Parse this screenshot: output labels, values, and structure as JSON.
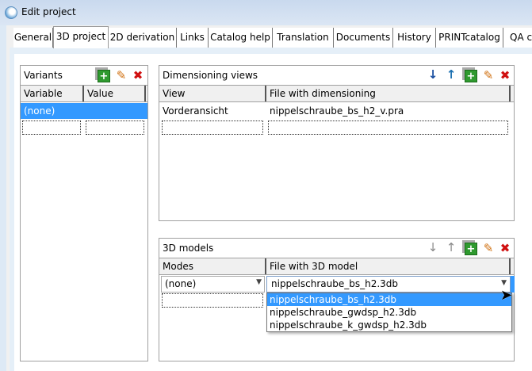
{
  "window": {
    "title": "Edit project"
  },
  "tabs": [
    {
      "label": "General"
    },
    {
      "label": "3D project",
      "selected": true
    },
    {
      "label": "2D derivation"
    },
    {
      "label": "Links"
    },
    {
      "label": "Catalog help"
    },
    {
      "label": "Translation"
    },
    {
      "label": "Documents"
    },
    {
      "label": "History"
    },
    {
      "label": "PRINTcatalog"
    },
    {
      "label": "QA cl"
    }
  ],
  "variants": {
    "title": "Variants",
    "columns": [
      "Variable",
      "Value"
    ],
    "rows": [
      {
        "variable": "(none)",
        "value": ""
      }
    ]
  },
  "dimensioning": {
    "title": "Dimensioning views",
    "columns": [
      "View",
      "File with dimensioning"
    ],
    "rows": [
      {
        "view": "Vorderansicht",
        "file": "nippelschraube_bs_h2_v.pra"
      }
    ]
  },
  "models": {
    "title": "3D models",
    "columns": [
      "Modes",
      "File with 3D model"
    ],
    "rows": [
      {
        "mode": "(none)",
        "file": "nippelschraube_bs_h2.3db"
      }
    ],
    "options": [
      "nippelschraube_bs_h2.3db",
      "nippelschraube_gwdsp_h2.3db",
      "nippelschraube_k_gwdsp_h2.3db"
    ]
  },
  "icons": {
    "down": "arrow-down-icon",
    "up": "arrow-up-icon",
    "add": "add-icon",
    "edit": "edit-icon",
    "delete": "delete-icon"
  },
  "colors": {
    "selection": "#3399ff",
    "delete": "#d01010",
    "add": "#2f9a2f"
  }
}
